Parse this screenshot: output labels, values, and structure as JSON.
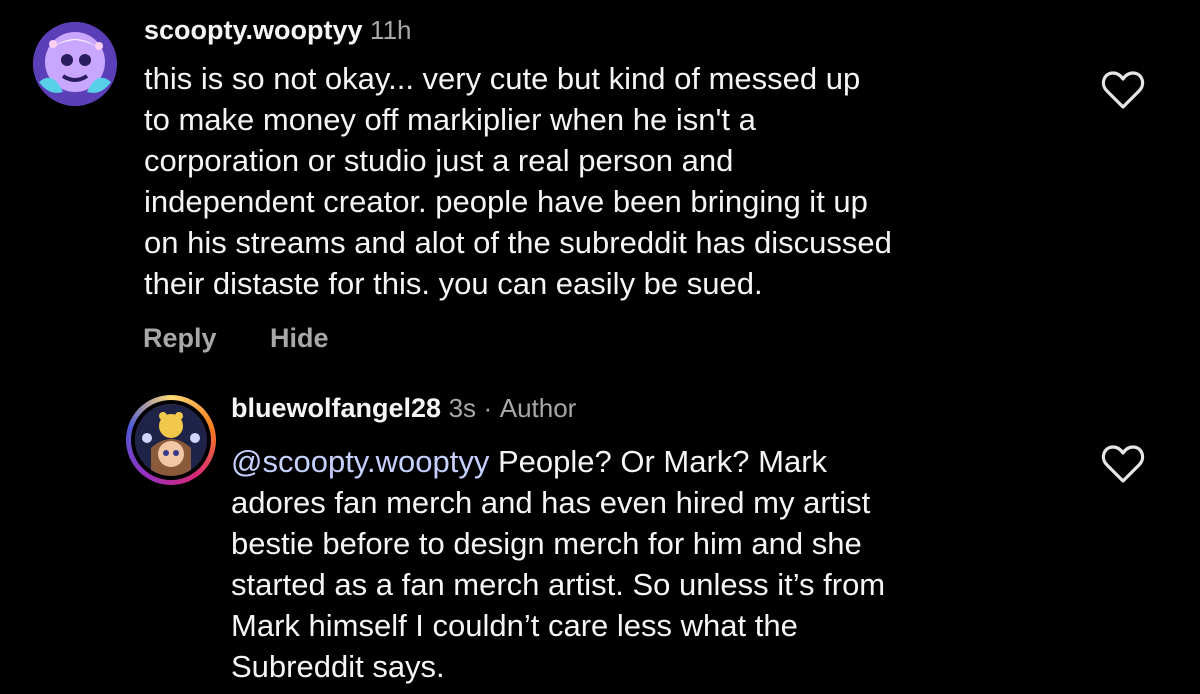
{
  "comments": [
    {
      "username": "scoopty.wooptyy",
      "time": "11h",
      "lines": [
        "this is so not okay... very cute but kind of messed up",
        "to make money off markiplier when he isn't a",
        "corporation or studio just a real person and",
        "independent creator. people have been bringing it up",
        "on his streams and alot of the subreddit has discussed",
        "their distaste for this. you can easily be sued."
      ],
      "actions": {
        "reply": "Reply",
        "hide": "Hide"
      },
      "like_icon": "heart-outline-icon"
    },
    {
      "username": "bluewolfangel28",
      "time": "3s",
      "separator": "·",
      "author_badge": "Author",
      "mention": "@scoopty.wooptyy",
      "first_line_rest": " People? Or Mark? Mark",
      "lines": [
        "adores fan merch and has even hired my artist",
        "bestie before to design merch for him and she",
        "started as a fan merch artist. So unless it’s from",
        "Mark himself I couldn’t care less what the",
        "Subreddit says."
      ],
      "like_icon": "heart-outline-icon"
    }
  ],
  "colors": {
    "background": "#000000",
    "text": "#f5f5f5",
    "secondary": "#a8a8a8",
    "mention": "#c6d0ff"
  }
}
